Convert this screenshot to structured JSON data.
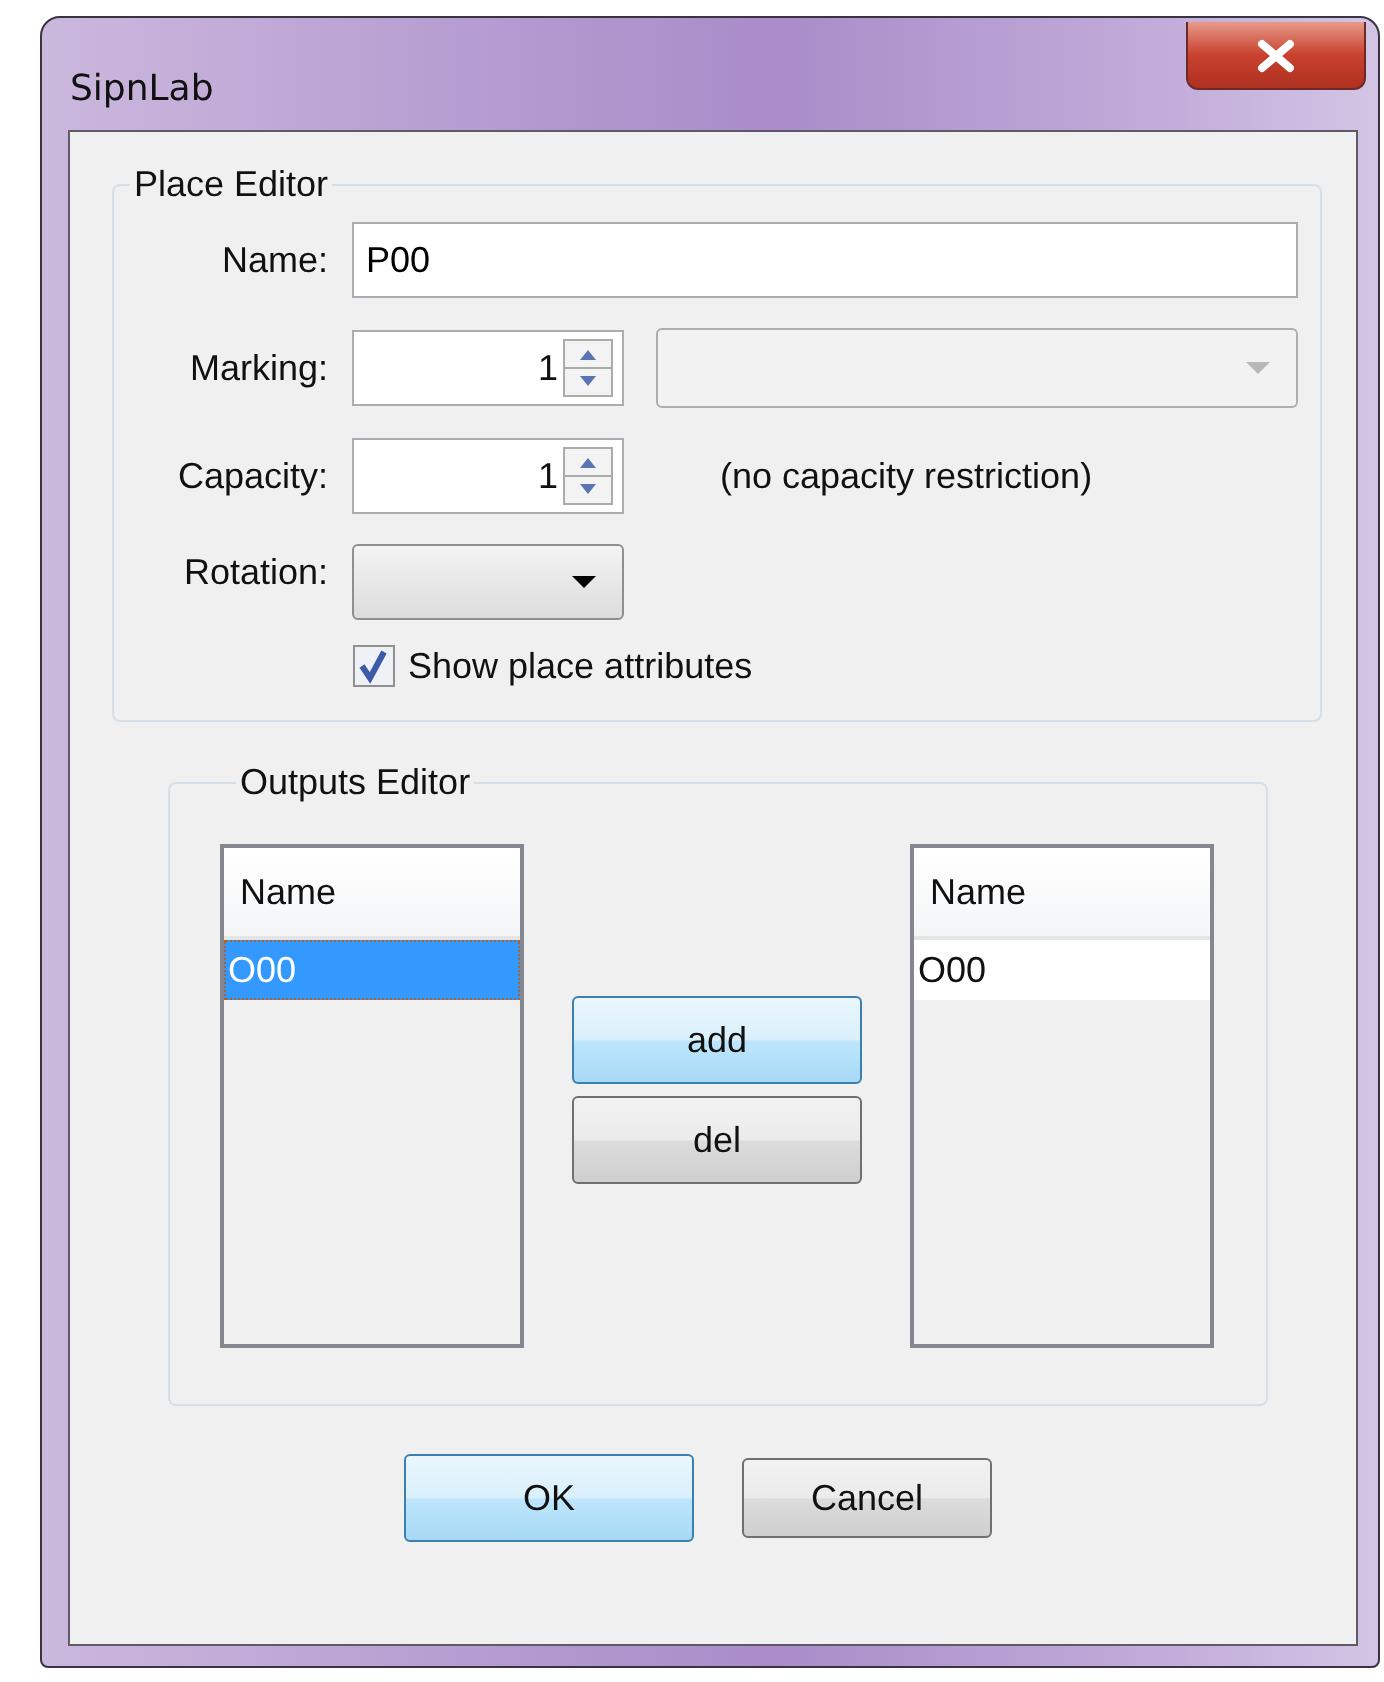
{
  "window": {
    "title": "SipnLab"
  },
  "place_editor": {
    "title": "Place Editor",
    "name": {
      "label": "Name:",
      "value": "P00"
    },
    "marking": {
      "label": "Marking:",
      "value": "1",
      "combo_disabled": true
    },
    "capacity": {
      "label": "Capacity:",
      "value": "1",
      "note": "(no capacity restriction)"
    },
    "rotation": {
      "label": "Rotation:"
    },
    "show_attributes": {
      "label": "Show place attributes",
      "checked": true
    }
  },
  "outputs_editor": {
    "title": "Outputs Editor",
    "lists": [
      {
        "header": "Name",
        "items": [
          {
            "text": "O00",
            "selected": true
          }
        ]
      },
      {
        "header": "Name",
        "items": [
          {
            "text": "O00",
            "selected": false
          }
        ]
      }
    ],
    "buttons": [
      {
        "label": "add",
        "focused": true
      },
      {
        "label": "del",
        "focused": false
      }
    ]
  },
  "dialog_buttons": [
    {
      "label": "OK",
      "default": true
    },
    {
      "label": "Cancel",
      "default": false
    }
  ]
}
